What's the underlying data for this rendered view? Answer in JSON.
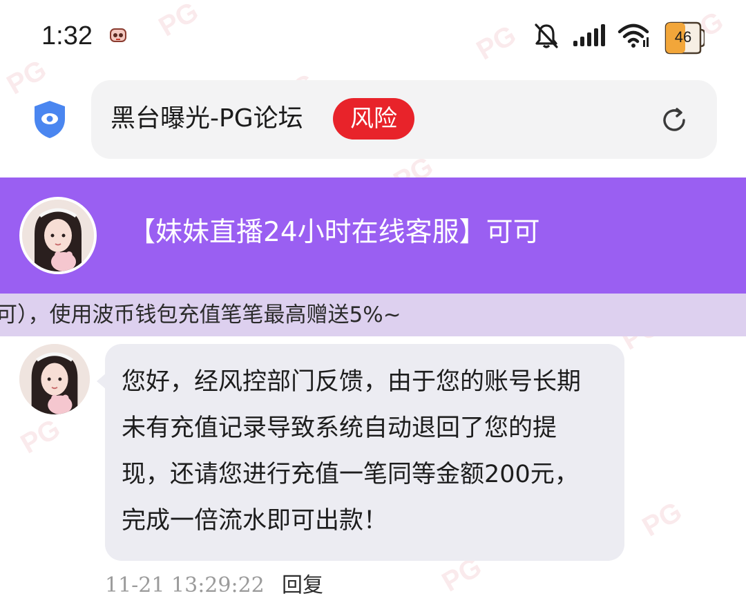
{
  "status_bar": {
    "time": "1:32",
    "battery_level": "46",
    "icons": [
      "app-notification-icon",
      "mute-bell-icon",
      "signal-icon",
      "wifi-icon",
      "battery-icon"
    ]
  },
  "url_bar": {
    "title": "黑台曝光-PG论坛",
    "risk_badge": "风险",
    "icons": [
      "shield-eye-icon",
      "reload-icon"
    ]
  },
  "chat_header": {
    "title": "【妹妹直播24小时在线客服】可可"
  },
  "notice": {
    "text": "可），使用波币钱包充值笔笔最高赠送5%~"
  },
  "message": {
    "text": "您好，经风控部门反馈，由于您的账号长期未有充值记录导致系统自动退回了您的提现，还请您进行充值一笔同等金额200元，完成一倍流水即可出款！",
    "time": "11-21 13:29:22",
    "reply_label": "回复"
  },
  "watermark": {
    "text": "PG"
  },
  "colors": {
    "header_purple": "#9a5ff2",
    "notice_lilac": "#ddd0ef",
    "risk_red": "#e8232a",
    "bubble_gray": "#ececf2",
    "shield_blue": "#4a86f0"
  }
}
